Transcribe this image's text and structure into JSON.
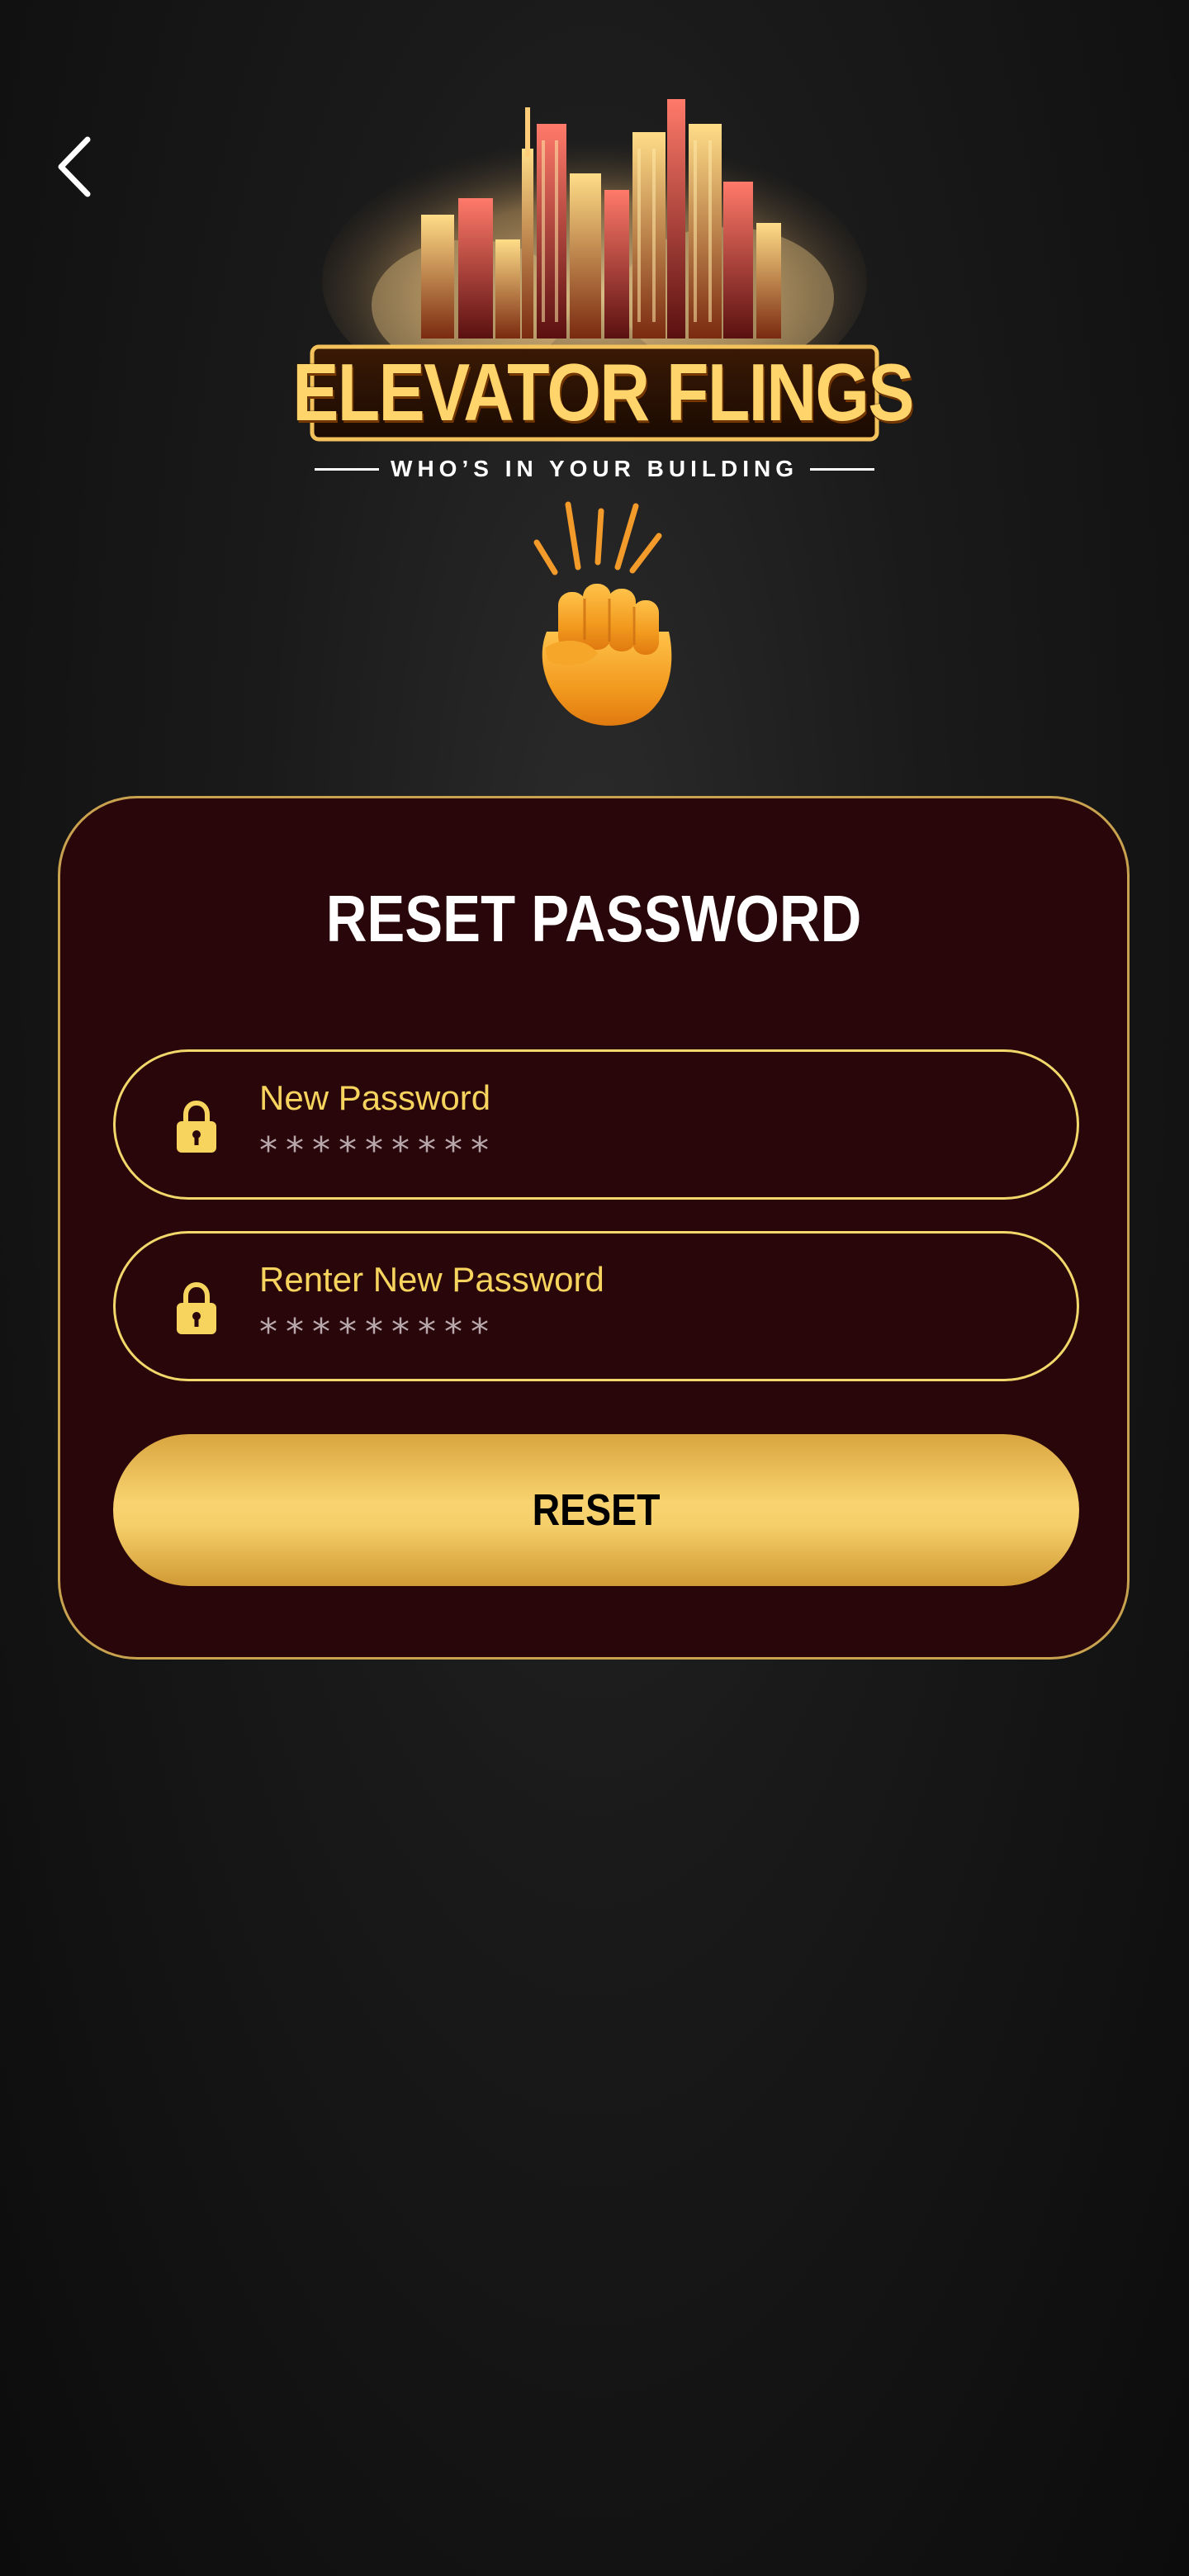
{
  "header": {
    "back_icon": "chevron-left-icon"
  },
  "logo": {
    "title": "ELEVATOR FLINGS",
    "tagline": "WHO’S IN YOUR BUILDING"
  },
  "emoji": {
    "icon": "raised-fist-icon"
  },
  "card": {
    "title": "RESET PASSWORD",
    "fields": [
      {
        "label": "New Password",
        "value": "*********",
        "icon": "lock-icon"
      },
      {
        "label": "Renter New Password",
        "value": "*********",
        "icon": "lock-icon"
      }
    ],
    "button_label": "RESET"
  },
  "colors": {
    "accent_gold": "#f2d86b",
    "card_bg": "#28060a",
    "card_border": "#c9a24f",
    "button_gold": "#f5cf6a"
  }
}
